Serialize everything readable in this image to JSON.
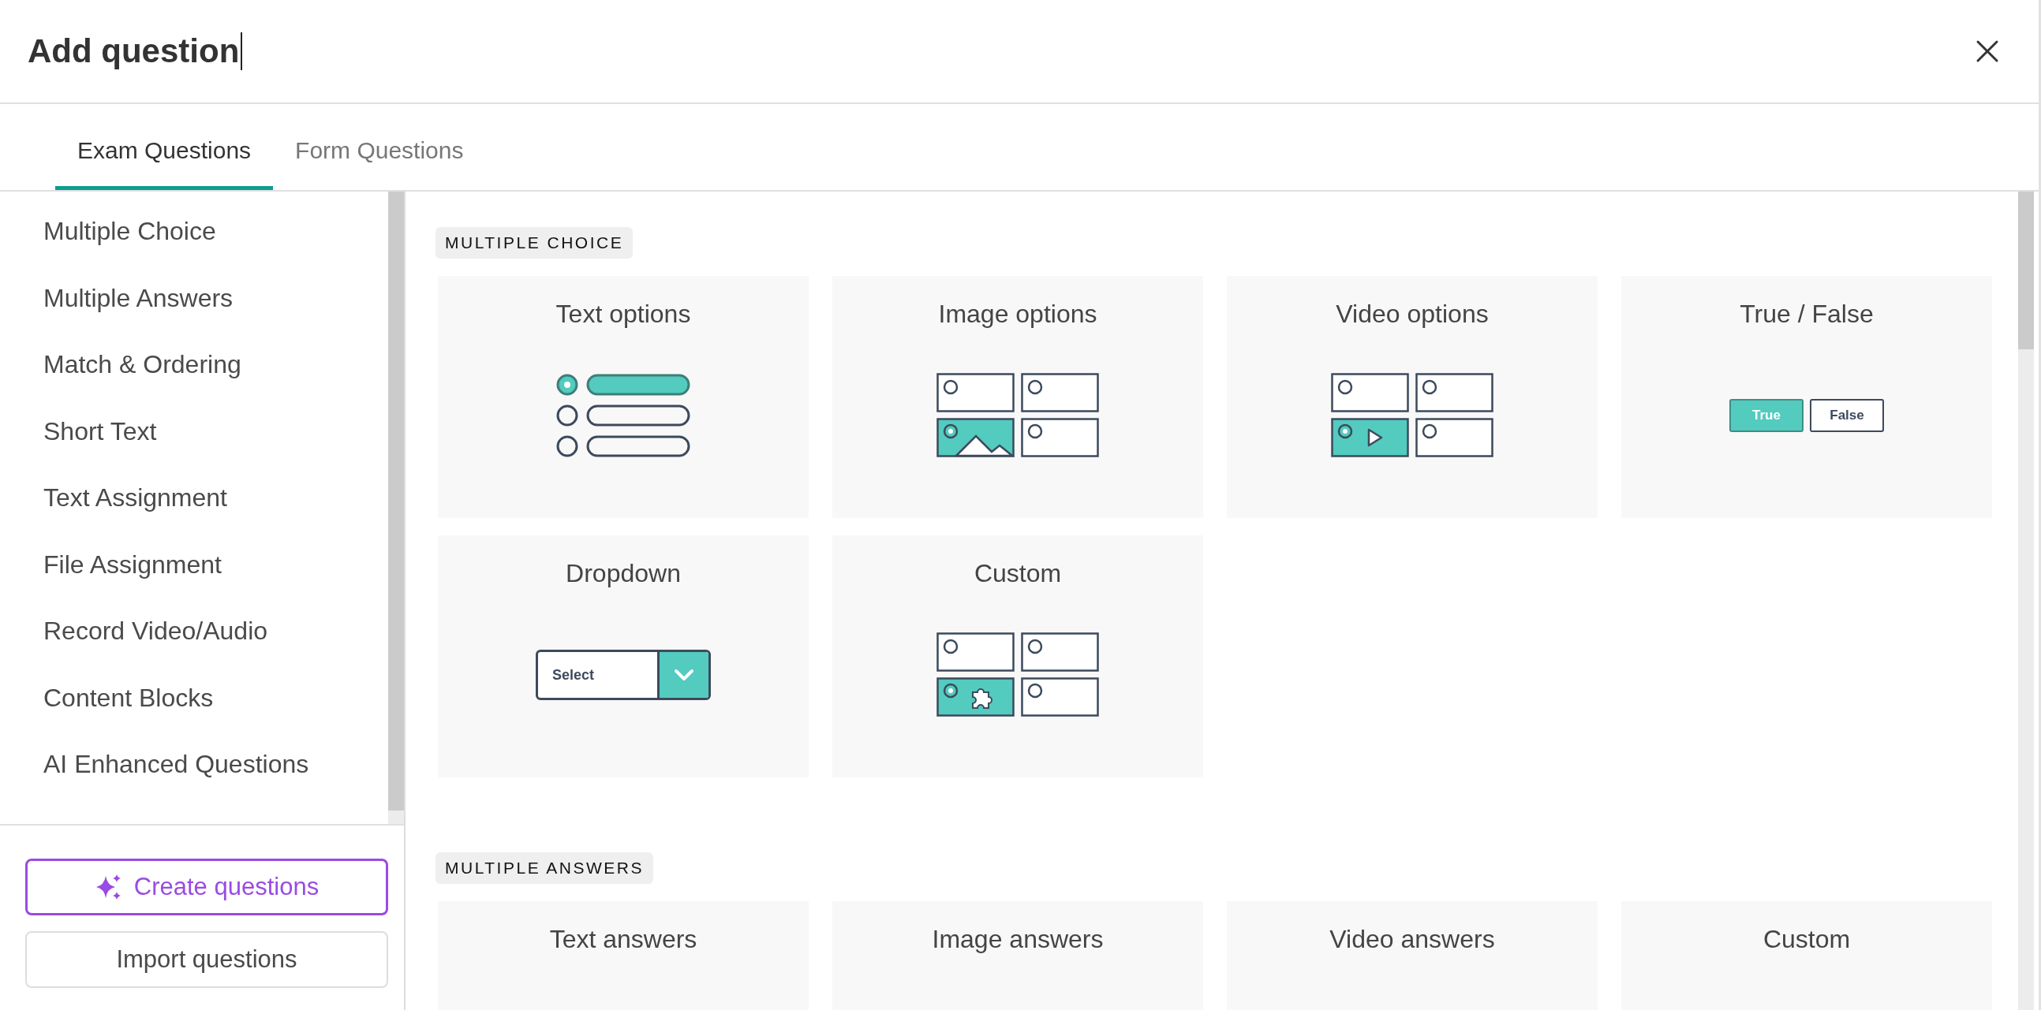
{
  "title": "Add question",
  "tabs": [
    {
      "label": "Exam Questions",
      "selected": true
    },
    {
      "label": "Form Questions",
      "selected": false
    }
  ],
  "sidebar": {
    "items": [
      {
        "label": "Multiple Choice"
      },
      {
        "label": "Multiple Answers"
      },
      {
        "label": "Match & Ordering"
      },
      {
        "label": "Short Text"
      },
      {
        "label": "Text Assignment"
      },
      {
        "label": "File Assignment"
      },
      {
        "label": "Record Video/Audio"
      },
      {
        "label": "Content Blocks"
      },
      {
        "label": "AI Enhanced Questions"
      }
    ],
    "buttons": [
      {
        "label": "Create questions",
        "kind": "ai"
      },
      {
        "label": "Import questions",
        "kind": "plain"
      }
    ]
  },
  "sections": [
    {
      "heading": "MULTIPLE CHOICE",
      "cards": [
        {
          "title": "Text options",
          "kind": "text"
        },
        {
          "title": "Image options",
          "kind": "image"
        },
        {
          "title": "Video options",
          "kind": "video"
        },
        {
          "title": "True / False",
          "kind": "true_false",
          "options": [
            "True",
            "False"
          ]
        },
        {
          "title": "Dropdown",
          "kind": "dropdown",
          "placeholder": "Select"
        },
        {
          "title": "Custom",
          "kind": "custom"
        }
      ]
    },
    {
      "heading": "MULTIPLE ANSWERS",
      "cards": [
        {
          "title": "Text answers",
          "kind": "cut"
        },
        {
          "title": "Image answers",
          "kind": "cut"
        },
        {
          "title": "Video answers",
          "kind": "cut"
        },
        {
          "title": "Custom",
          "kind": "cut"
        }
      ]
    }
  ]
}
